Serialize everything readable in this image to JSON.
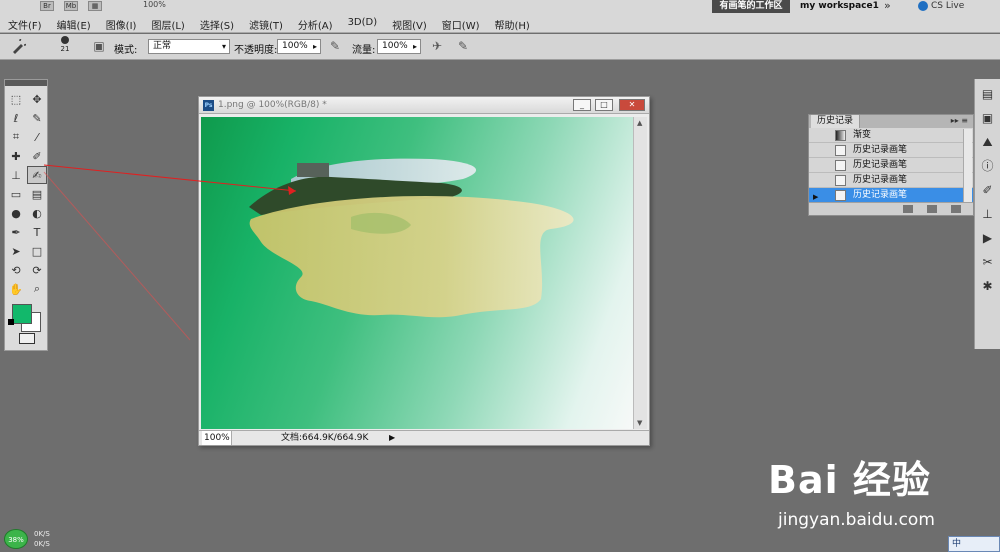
{
  "menubar": {
    "items": [
      "文件(F)",
      "编辑(E)",
      "图像(I)",
      "图层(L)",
      "选择(S)",
      "滤镜(T)",
      "分析(A)",
      "3D(D)",
      "视图(V)",
      "窗口(W)",
      "帮助(H)"
    ],
    "zoom_text": "100%",
    "workspace_active": "有画笔的工作区",
    "workspace_other": "my workspace1",
    "more_glyph": "»",
    "cs_live": "CS Live"
  },
  "options": {
    "brush_size": "21",
    "mode_label": "模式:",
    "mode_value": "正常",
    "opacity_label": "不透明度:",
    "opacity_value": "100%",
    "flow_label": "流量:",
    "flow_value": "100%"
  },
  "tools": {
    "items": [
      {
        "name": "marquee-tool",
        "glyph": "⬚"
      },
      {
        "name": "move-tool",
        "glyph": "✥"
      },
      {
        "name": "lasso-tool",
        "glyph": "ℓ"
      },
      {
        "name": "quick-select-tool",
        "glyph": "✎"
      },
      {
        "name": "crop-tool",
        "glyph": "⌗"
      },
      {
        "name": "eyedropper-tool",
        "glyph": "⁄"
      },
      {
        "name": "healing-brush-tool",
        "glyph": "✚"
      },
      {
        "name": "brush-tool",
        "glyph": "✐"
      },
      {
        "name": "clone-stamp-tool",
        "glyph": "⊥"
      },
      {
        "name": "history-brush-tool",
        "glyph": "✍"
      },
      {
        "name": "eraser-tool",
        "glyph": "▭"
      },
      {
        "name": "gradient-tool",
        "glyph": "▤"
      },
      {
        "name": "blur-tool",
        "glyph": "●"
      },
      {
        "name": "dodge-tool",
        "glyph": "◐"
      },
      {
        "name": "pen-tool",
        "glyph": "✒"
      },
      {
        "name": "type-tool",
        "glyph": "T"
      },
      {
        "name": "path-select-tool",
        "glyph": "➤"
      },
      {
        "name": "shape-tool",
        "glyph": "□"
      },
      {
        "name": "3d-rotate-tool",
        "glyph": "⟲"
      },
      {
        "name": "3d-orbit-tool",
        "glyph": "⟳"
      },
      {
        "name": "hand-tool",
        "glyph": "✋"
      },
      {
        "name": "zoom-tool",
        "glyph": "⌕"
      }
    ],
    "foreground_color": "#12b86b",
    "background_color": "#ffffff"
  },
  "document": {
    "title": "1.png @ 100%(RGB/8) *",
    "ps_badge": "Ps",
    "zoom": "100%",
    "doc_info": "文档:664.9K/664.9K",
    "minimize": "_",
    "maximize": "□",
    "close": "✕"
  },
  "history": {
    "tab": "历史记录",
    "rows": [
      {
        "label": "渐变",
        "icon": "gradient"
      },
      {
        "label": "历史记录画笔",
        "icon": "doc"
      },
      {
        "label": "历史记录画笔",
        "icon": "doc"
      },
      {
        "label": "历史记录画笔",
        "icon": "doc"
      },
      {
        "label": "历史记录画笔",
        "icon": "doc",
        "selected": true
      }
    ]
  },
  "tray": {
    "percent": "38%",
    "up": "0K/S",
    "down": "0K/S"
  },
  "ime": "中",
  "watermark": {
    "logo": "Bai 经验",
    "url": "jingyan.baidu.com"
  }
}
